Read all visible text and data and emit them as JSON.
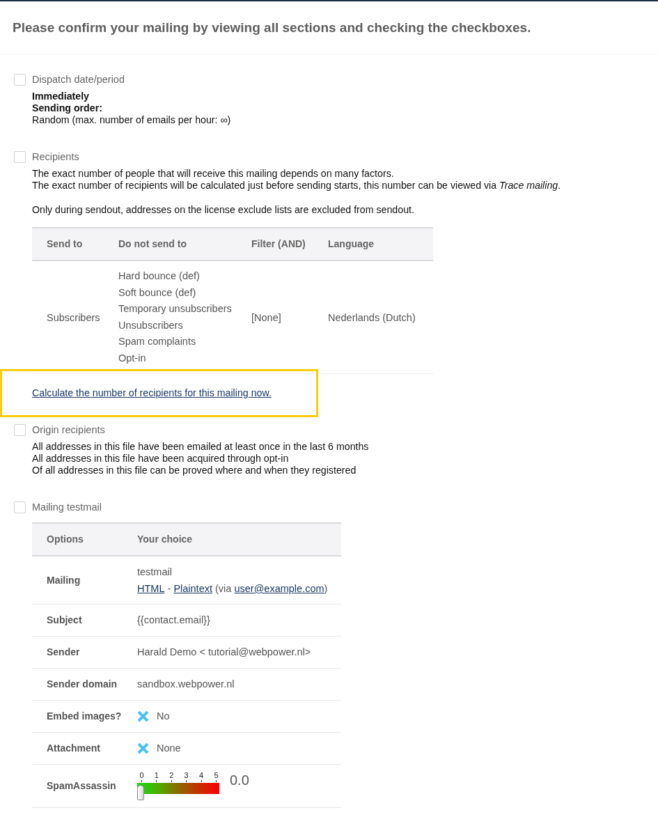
{
  "header": {
    "title": "Please confirm your mailing by viewing all sections and checking the checkboxes."
  },
  "sections": [
    {
      "title": "Dispatch date/period",
      "checked": false,
      "paragraphs": [
        {
          "lines": [
            {
              "text": "Immediately",
              "bold": true
            },
            {
              "text": "Sending order:",
              "bold": true
            },
            {
              "text": "Random (max. number of emails per hour: ∞)",
              "bold": false
            }
          ]
        }
      ]
    },
    {
      "title": "Recipients",
      "checked": false,
      "paragraphs": [
        {
          "lines": [
            {
              "text": "The exact number of people that will receive this mailing depends on many factors.",
              "bold": false
            },
            {
              "text": "The exact number of recipients will be calculated just before sending starts, this number can be viewed via *Trace mailing*.",
              "bold": false
            }
          ]
        },
        {
          "lines": [
            {
              "text": "Only during sendout, addresses on the license exclude lists are excluded from sendout.",
              "bold": false
            }
          ]
        }
      ],
      "recipient_table": {
        "columns": [
          "Send to",
          "Do not send to",
          "Filter (AND)",
          "Language"
        ],
        "rows": [
          {
            "send_to": "Subscribers",
            "do_not_send_to": [
              "Hard bounce (def)",
              "Soft bounce (def)",
              "Temporary unsubscribers",
              "Unsubscribers",
              "Spam complaints",
              "Opt-in"
            ],
            "filter": "[None]",
            "language": "Nederlands (Dutch)"
          }
        ]
      },
      "link": {
        "text": "Calculate the number of recipients for this mailing now.",
        "highlighted": true
      }
    },
    {
      "title": "Origin recipients",
      "checked": false,
      "paragraphs": [
        {
          "lines": [
            {
              "text": "All addresses in this file have been emailed at least once in the last 6 months",
              "bold": false
            },
            {
              "text": "All addresses in this file have been acquired through opt-in",
              "bold": false
            },
            {
              "text": "Of all addresses in this file can be proved where and when they registered",
              "bold": false
            }
          ]
        }
      ]
    },
    {
      "title": "Mailing testmail",
      "checked": false,
      "options_table": {
        "columns": [
          "Options",
          "Your choice"
        ],
        "rows": [
          {
            "label": "Mailing",
            "kind": "links",
            "value": "testmail",
            "parts": [
              {
                "text": "HTML",
                "kind": "link"
              },
              {
                "text": " - ",
                "kind": "text"
              },
              {
                "text": "Plaintext",
                "kind": "link"
              },
              {
                "text": " (via ",
                "kind": "text"
              },
              {
                "text": "user@example.com",
                "kind": "link"
              },
              {
                "text": ")",
                "kind": "text"
              }
            ]
          },
          {
            "label": "Subject",
            "kind": "text",
            "value": "{{contact.email}}"
          },
          {
            "label": "Sender",
            "kind": "text",
            "value": "Harald Demo < tutorial@webpower.nl>"
          },
          {
            "label": "Sender domain",
            "kind": "text",
            "value": "sandbox.webpower.nl"
          },
          {
            "label": "Embed images?",
            "kind": "cross",
            "value": "No"
          },
          {
            "label": "Attachment",
            "kind": "cross",
            "value": "None"
          },
          {
            "label": "SpamAssassin",
            "kind": "meter",
            "scale": [
              "0",
              "1",
              "2",
              "3",
              "4",
              "5"
            ],
            "level": 0,
            "reading": "0.0"
          }
        ]
      }
    }
  ]
}
